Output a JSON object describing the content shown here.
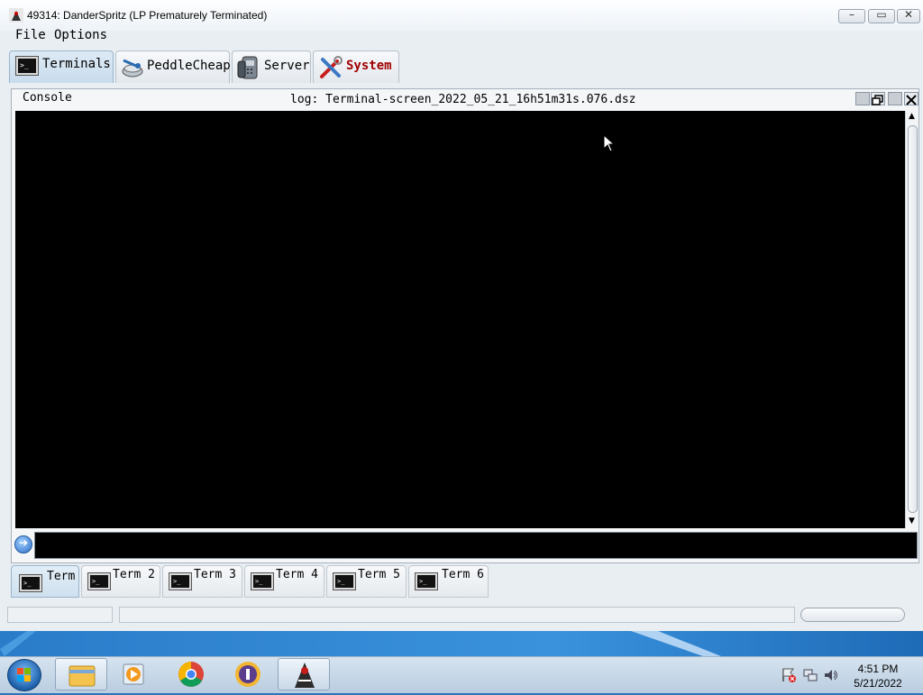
{
  "window": {
    "title": "49314: DanderSpritz (LP Prematurely Terminated)",
    "minimize_label": "–",
    "maximize_label": "▭",
    "close_label": "✕"
  },
  "menu": [
    "File",
    "Options"
  ],
  "main_tabs": [
    {
      "label": "Terminals",
      "icon": "terminal-icon",
      "active": true
    },
    {
      "label": "PeddleCheap",
      "icon": "peddlecheap-icon"
    },
    {
      "label": "Server",
      "icon": "phone-icon"
    },
    {
      "label": "System",
      "icon": "tools-icon"
    }
  ],
  "console_frame": {
    "title": "Console",
    "log": "log: Terminal-screen_2022_05_21_16h51m31s.076.dsz"
  },
  "command_input": {
    "value": ""
  },
  "term_tabs": [
    "Term",
    "Term 2",
    "Term 3",
    "Term 4",
    "Term 5",
    "Term 6"
  ],
  "taskbar": {
    "apps": [
      "file-explorer-icon",
      "media-player-icon",
      "chrome-icon",
      "keepass-icon",
      "danderspritz-icon"
    ],
    "time": "4:51 PM",
    "date": "5/21/2022"
  },
  "colors": {
    "accent_tab": "#c9dcec",
    "system_label": "#a00000",
    "console_bg": "#000000"
  }
}
